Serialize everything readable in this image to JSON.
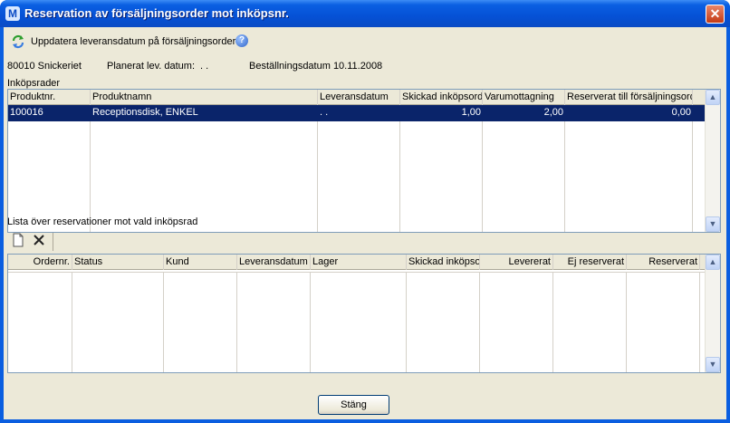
{
  "window": {
    "title": "Reservation av försäljningsorder mot inköpsnr.",
    "close_label": "✕",
    "app_icon_letter": "M"
  },
  "top": {
    "update_label": "Uppdatera leveransdatum på försäljningsorder",
    "help_label": "?",
    "supplier": "80010 Snickeriet",
    "planned_label": "Planerat lev. datum:",
    "planned_value": ". .",
    "order_date_label": "Beställningsdatum 10.11.2008",
    "section_label": "Inköpsrader"
  },
  "purchase_grid": {
    "headers": [
      "Produktnr.",
      "Produktnamn",
      "Leveransdatum",
      "Skickad inköpsorder",
      "Varumottagning",
      "Reserverat till försäljningsorder"
    ],
    "rows": [
      {
        "product_no": "100016",
        "product_name": "Receptionsdisk, ENKEL",
        "delivery_date": ". .",
        "sent": "1,00",
        "received": "2,00",
        "reserved": "0,00"
      }
    ]
  },
  "reservations": {
    "section_label": "Lista över reservationer mot vald inköpsrad",
    "new_icon": "new-document-icon",
    "delete_icon": "delete-x-icon",
    "headers": [
      "Ordernr.",
      "Status",
      "Kund",
      "Leveransdatum",
      "Lager",
      "Skickad inköpsorder",
      "Levererat",
      "Ej reserverat",
      "Reserverat"
    ]
  },
  "footer": {
    "close_button": "Stäng"
  },
  "colors": {
    "selection": "#0a246a",
    "title_blue": "#0a5fe2",
    "panel": "#ece9d8"
  }
}
